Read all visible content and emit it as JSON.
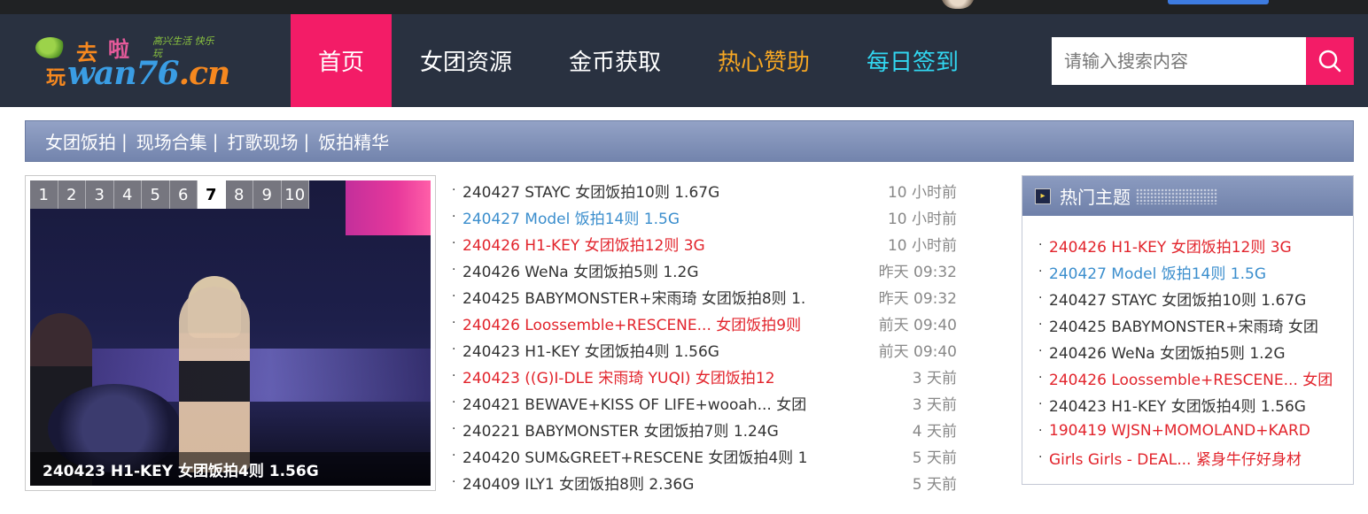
{
  "colors": {
    "header_bg": "#293140",
    "accent": "#f31c67",
    "nav_gold": "#f5a623",
    "nav_cyan": "#31d6f0",
    "link_blue": "#3b8ecd",
    "link_red": "#e2242c"
  },
  "logo": {
    "text_main": "wan76",
    "text_domain": ".cn",
    "text_char1": "去",
    "text_char2": "啦",
    "text_char3": "玩",
    "tagline": "高兴生活 快乐玩"
  },
  "nav": {
    "items": [
      {
        "label": "首页",
        "color": "#ffffff"
      },
      {
        "label": "女团资源",
        "color": "#ffffff"
      },
      {
        "label": "金币获取",
        "color": "#ffffff"
      },
      {
        "label": "热心赞助",
        "color": "#f5a623"
      },
      {
        "label": "每日签到",
        "color": "#31d6f0"
      }
    ]
  },
  "search": {
    "placeholder": "请输入搜索内容",
    "icon": "search-icon"
  },
  "subnav": {
    "items": [
      "女团饭拍",
      "现场合集",
      "打歌现场",
      "饭拍精华"
    ],
    "separator": "|"
  },
  "slider": {
    "pages": [
      "1",
      "2",
      "3",
      "4",
      "5",
      "6",
      "7",
      "8",
      "9",
      "10"
    ],
    "current": "7",
    "caption": "240423 H1-KEY 女团饭拍4则 1.56G"
  },
  "list": {
    "bullet": "·",
    "rows": [
      {
        "title": "240427 STAYC 女团饭拍10则 1.67G",
        "time": "10 小时前",
        "color": "dark"
      },
      {
        "title": "240427 Model 饭拍14则 1.5G",
        "time": "10 小时前",
        "color": "blue"
      },
      {
        "title": "240426 H1-KEY 女团饭拍12则 3G",
        "time": "10 小时前",
        "color": "red"
      },
      {
        "title": "240426 WeNa 女团饭拍5则 1.2G",
        "time": "昨天 09:32",
        "color": "dark"
      },
      {
        "title": "240425 BABYMONSTER+宋雨琦 女团饭拍8则 1.",
        "time": "昨天 09:32",
        "color": "dark"
      },
      {
        "title": "240426 Loossemble+RESCENE... 女团饭拍9则",
        "time": "前天 09:40",
        "color": "red"
      },
      {
        "title": "240423 H1-KEY 女团饭拍4则 1.56G",
        "time": "前天 09:40",
        "color": "dark"
      },
      {
        "title": "240423 ((G)I-DLE 宋雨琦 YUQI) 女团饭拍12",
        "time": "3 天前",
        "color": "red"
      },
      {
        "title": "240421 BEWAVE+KISS OF LIFE+wooah... 女团",
        "time": "3 天前",
        "color": "dark"
      },
      {
        "title": "240221 BABYMONSTER 女团饭拍7则 1.24G",
        "time": "4 天前",
        "color": "dark"
      },
      {
        "title": "240420 SUM&GREET+RESCENE 女团饭拍4则 1",
        "time": "5 天前",
        "color": "dark"
      },
      {
        "title": "240409 ILY1 女团饭拍8则 2.36G",
        "time": "5 天前",
        "color": "dark"
      }
    ]
  },
  "hot": {
    "title": "热门主题",
    "items": [
      {
        "title": "240426 H1-KEY 女团饭拍12则 3G",
        "color": "red"
      },
      {
        "title": "240427 Model 饭拍14则 1.5G",
        "color": "blue"
      },
      {
        "title": "240427 STAYC 女团饭拍10则 1.67G",
        "color": "dark"
      },
      {
        "title": "240425 BABYMONSTER+宋雨琦 女团",
        "color": "dark"
      },
      {
        "title": "240426 WeNa 女团饭拍5则 1.2G",
        "color": "dark"
      },
      {
        "title": "240426 Loossemble+RESCENE... 女团",
        "color": "red"
      },
      {
        "title": "240423 H1-KEY 女团饭拍4则 1.56G",
        "color": "dark"
      },
      {
        "title": "190419 WJSN+MOMOLAND+KARD",
        "color": "red"
      },
      {
        "title": "Girls Girls - DEAL... 紧身牛仔好身材",
        "color": "red"
      }
    ]
  }
}
